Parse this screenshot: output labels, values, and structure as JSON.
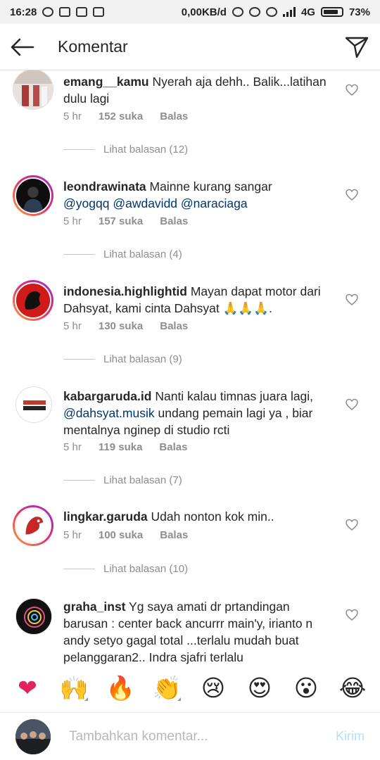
{
  "status_bar": {
    "time": "16:28",
    "network_speed": "0,00KB/d",
    "network_type": "4G",
    "battery": "73%"
  },
  "header": {
    "title": "Komentar",
    "back_icon": "arrow-left-icon",
    "send_icon": "paper-plane-icon"
  },
  "comments": [
    {
      "username": "emang__kamu",
      "text": "Nyerah aja dehh.. Balik...latihan dulu lagi",
      "time": "5 hr",
      "likes": "152 suka",
      "reply": "Balas",
      "view_replies": "Lihat balasan (12)"
    },
    {
      "username": "leondrawinata",
      "text": "Mainne kurang sangar",
      "mentions": [
        "@yogqq",
        "@awdavidd",
        "@naraciaga"
      ],
      "time": "5 hr",
      "likes": "157 suka",
      "reply": "Balas",
      "view_replies": "Lihat balasan (4)"
    },
    {
      "username": "indonesia.highlightid",
      "text": "Mayan dapat motor dari Dahsyat, kami cinta Dahsyat 🙏🙏🙏.",
      "time": "5 hr",
      "likes": "130 suka",
      "reply": "Balas",
      "view_replies": "Lihat balasan (9)"
    },
    {
      "username": "kabargaruda.id",
      "text_before": "Nanti kalau timnas juara lagi,",
      "mention": "@dahsyat.musik",
      "text_after": "undang pemain lagi ya , biar mentalnya nginep di studio rcti",
      "time": "5 hr",
      "likes": "119 suka",
      "reply": "Balas",
      "view_replies": "Lihat balasan (7)"
    },
    {
      "username": "lingkar.garuda",
      "text": "Udah nonton kok min..",
      "time": "5 hr",
      "likes": "100 suka",
      "reply": "Balas",
      "view_replies": "Lihat balasan (10)"
    },
    {
      "username": "graha_inst",
      "text": "Yg saya amati dr prtandingan barusan : center back ancurrr main'y, irianto n andy setyo gagal total ...terlalu mudah buat pelanggaran2.. Indra sjafri terlalu"
    }
  ],
  "emoji_bar": [
    "❤",
    "🙌",
    "🔥",
    "👏",
    "😢",
    "😍",
    "😮",
    "😂"
  ],
  "composer": {
    "placeholder": "Tambahkan komentar...",
    "post_label": "Kirim"
  },
  "colors": {
    "mention": "#003569",
    "muted": "#8e8e8e",
    "post_disabled": "#b2dffc",
    "heart": "#ed4956"
  }
}
